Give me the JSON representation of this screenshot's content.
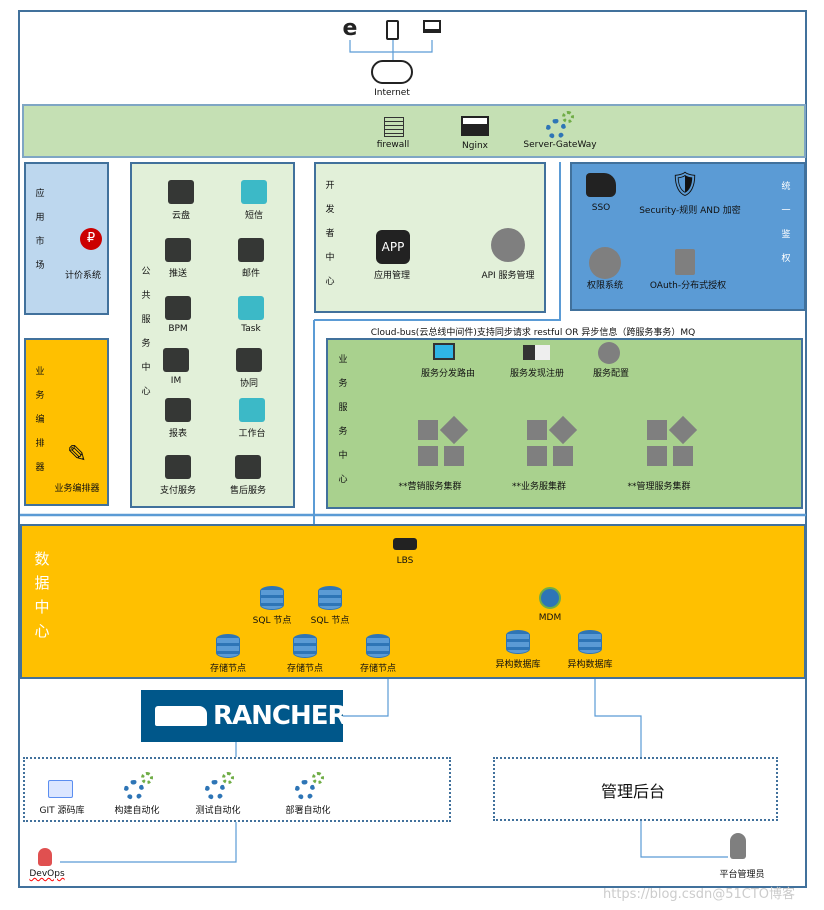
{
  "clients": {
    "icons": [
      "ie-icon",
      "phone-icon",
      "laptop-icon"
    ],
    "internet": "Internet"
  },
  "gateway": {
    "firewall": "firewall",
    "nginx": "Nginx",
    "server_gateway": "Server-GateWay"
  },
  "app_market": {
    "title": "应用市场",
    "item": "计价系统"
  },
  "orchestrator": {
    "title": "业务编排器",
    "item": "业务编排器"
  },
  "public_center": {
    "title": "公共服务中心",
    "items": [
      {
        "label": "云盘"
      },
      {
        "label": "短信"
      },
      {
        "label": "推送"
      },
      {
        "label": "邮件"
      },
      {
        "label": "BPM"
      },
      {
        "label": "Task"
      },
      {
        "label": "IM"
      },
      {
        "label": "协同"
      },
      {
        "label": "报表"
      },
      {
        "label": "工作台"
      },
      {
        "label": "支付服务"
      },
      {
        "label": "售后服务"
      }
    ]
  },
  "dev_center": {
    "title": "开发者中心",
    "app_icon": "APP",
    "items": [
      {
        "label": "应用管理"
      },
      {
        "label": "API 服务管理"
      }
    ]
  },
  "auth": {
    "title": "统一鉴权",
    "items": [
      {
        "label": "SSO"
      },
      {
        "label": "Security-规则 AND 加密"
      },
      {
        "label": "权限系统"
      },
      {
        "label": "OAuth-分布式授权"
      }
    ]
  },
  "cloud_bus": "Cloud-bus(云总线中间件)支持同步请求 restful OR 异步信息（跨服务事务）MQ",
  "biz_center": {
    "title": "业务服务中心",
    "top": [
      {
        "label": "服务分发路由"
      },
      {
        "label": "服务发现注册"
      },
      {
        "label": "服务配置"
      }
    ],
    "clusters": [
      {
        "label": "**营销服务集群"
      },
      {
        "label": "**业务服集群"
      },
      {
        "label": "**管理服务集群"
      }
    ]
  },
  "data_center": {
    "title": "数据中心",
    "lbs": "LBS",
    "sql": [
      "SQL 节点",
      "SQL 节点"
    ],
    "storage": [
      "存储节点",
      "存储节点",
      "存储节点"
    ],
    "mdm": "MDM",
    "hetero": [
      "异构数据库",
      "异构数据库"
    ]
  },
  "rancher": "RANCHER",
  "devops": {
    "items": [
      {
        "label": "GIT 源码库"
      },
      {
        "label": "构建自动化"
      },
      {
        "label": "测试自动化"
      },
      {
        "label": "部署自动化"
      }
    ],
    "person": "DevOps"
  },
  "admin": {
    "title": "管理后台",
    "person": "平台管理员"
  },
  "watermark": "https://blog.csdn@51CTO博客",
  "colors": {
    "frame": "#41719c",
    "gateway": "#c5e0b4",
    "light_green": "#e2f0d9",
    "green": "#a9d18e",
    "blue": "#5b9bd5",
    "light_blue": "#bdd7ee",
    "orange": "#ffc000",
    "rancher": "#00578a"
  }
}
